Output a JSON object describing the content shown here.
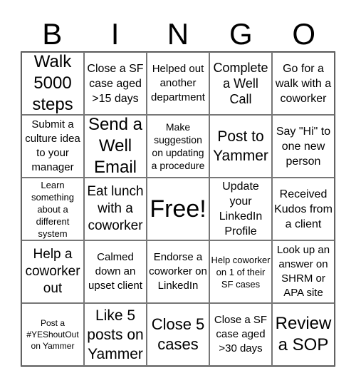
{
  "header": {
    "letters": [
      "B",
      "I",
      "N",
      "G",
      "O"
    ]
  },
  "cells": [
    "Walk 5000 steps",
    "Close a SF case aged >15 days",
    "Helped out another department",
    "Complete a Well Call",
    "Go for a walk with a coworker",
    "Submit a culture idea to your manager",
    "Send a Well Email",
    "Make suggestion on updating a procedure",
    "Post to Yammer",
    "Say \"Hi\" to one new person",
    "Learn something about a different system",
    "Eat lunch with a coworker",
    "Free!",
    "Update your LinkedIn Profile",
    "Received Kudos from a client",
    "Help a coworker out",
    "Calmed down an upset client",
    "Endorse a coworker on LinkedIn",
    "Help coworker on 1 of their SF cases",
    "Look up an answer on SHRM or APA site",
    "Post a #YEShoutOut on Yammer",
    "Like 5 posts on Yammer",
    "Close 5 cases",
    "Close a SF case aged >30 days",
    "Review a SOP"
  ]
}
